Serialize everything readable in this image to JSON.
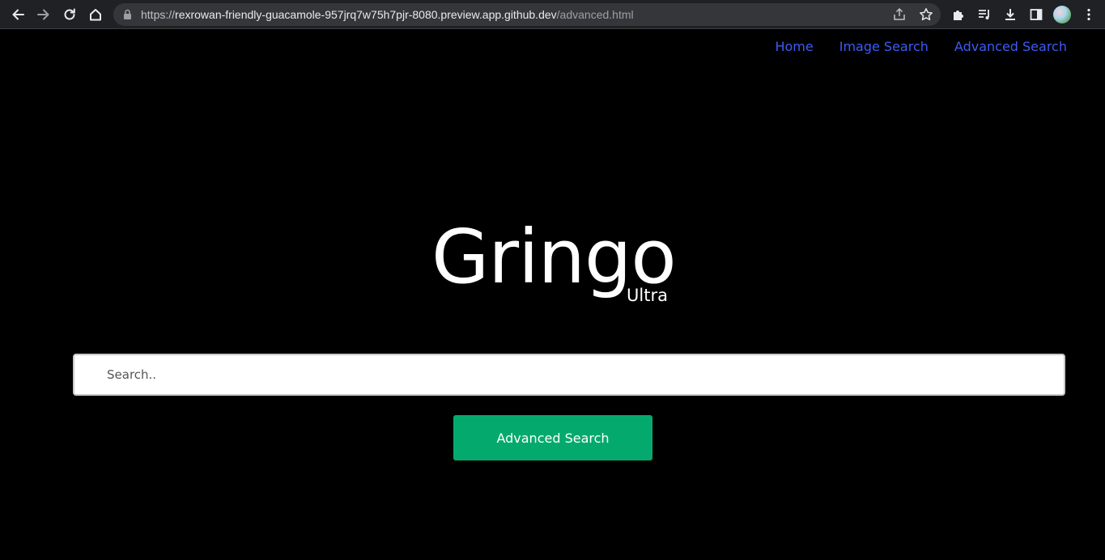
{
  "browser": {
    "url_scheme": "https://",
    "url_host": "rexrowan-friendly-guacamole-957jrq7w75h7pjr-8080.preview.app.github.dev",
    "url_path": "/advanced.html",
    "icons": [
      "back-arrow-icon",
      "forward-arrow-icon",
      "reload-icon",
      "home-icon",
      "lock-icon",
      "share-icon",
      "star-icon",
      "extensions-puzzle-icon",
      "media-queue-icon",
      "download-icon",
      "side-panel-icon",
      "profile-avatar",
      "kebab-menu-icon"
    ]
  },
  "nav": {
    "home": "Home",
    "image_search": "Image Search",
    "advanced_search": "Advanced Search",
    "link_color": "#3b5cf4"
  },
  "logo": {
    "main": "Gringo",
    "sub": "Ultra"
  },
  "search": {
    "placeholder": "Search..",
    "value": ""
  },
  "button": {
    "label": "Advanced Search",
    "color": "#04aa6d"
  }
}
